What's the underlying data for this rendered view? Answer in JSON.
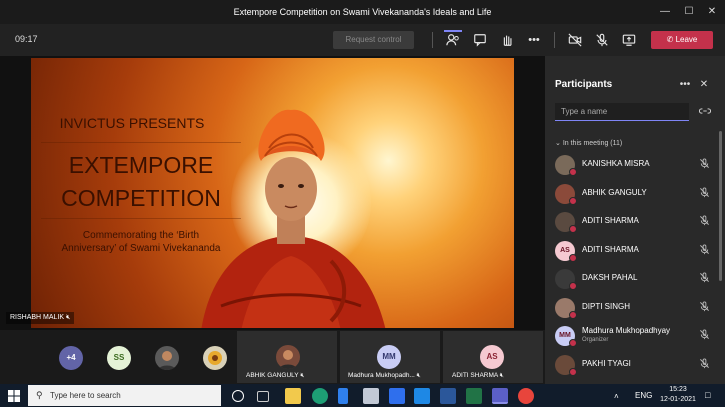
{
  "window": {
    "title": "Extempore Competition on Swami Vivekananda's Ideals and Life",
    "controls": [
      "—",
      "☐",
      "✕"
    ]
  },
  "toolbar": {
    "timer": "09:17",
    "request_control": "Request control",
    "leave": "Leave"
  },
  "slide": {
    "line1": "INVICTUS PRESENTS",
    "line2": "EXTEMPORE",
    "line3": "COMPETITION",
    "line4": "Commemorating the ‘Birth",
    "line5": "Anniversary’ of Swami Vivekananda"
  },
  "presenter": {
    "name": "RISHABH MALIK"
  },
  "panel": {
    "title": "Participants",
    "search_placeholder": "Type a name",
    "section": "In this meeting (11)",
    "participants": [
      {
        "name": "KANISHKA MISRA",
        "initials": "",
        "avatar_color": "#7a6a5a",
        "subtitle": ""
      },
      {
        "name": "ABHIK GANGULY",
        "initials": "",
        "avatar_color": "#8b4a3a",
        "subtitle": ""
      },
      {
        "name": "ADITI SHARMA",
        "initials": "",
        "avatar_color": "#5a4a40",
        "subtitle": ""
      },
      {
        "name": "ADITI SHARMA",
        "initials": "AS",
        "avatar_color": "#f5c9d1",
        "subtitle": ""
      },
      {
        "name": "DAKSH PAHAL",
        "initials": "",
        "avatar_color": "#3a3a3a",
        "subtitle": ""
      },
      {
        "name": "DIPTI SINGH",
        "initials": "",
        "avatar_color": "#9a7a6a",
        "subtitle": ""
      },
      {
        "name": "Madhura Mukhopadhyay",
        "initials": "MM",
        "avatar_color": "#c9cdf5",
        "subtitle": "Organizer"
      },
      {
        "name": "PAKHI TYAGI",
        "initials": "",
        "avatar_color": "#6a4a3a",
        "subtitle": ""
      }
    ]
  },
  "gallery": {
    "overflow": "+4",
    "ss_initials": "SS",
    "tile1_name": "ABHIK GANGULY",
    "tile2_initials": "MM",
    "tile2_name": "Madhura Mukhopadh...",
    "tile3_initials": "AS",
    "tile3_name": "ADITI SHARMA"
  },
  "taskbar": {
    "search_placeholder": "Type here to search",
    "lang": "ENG",
    "time": "15:23",
    "date": "12-01-2021"
  }
}
